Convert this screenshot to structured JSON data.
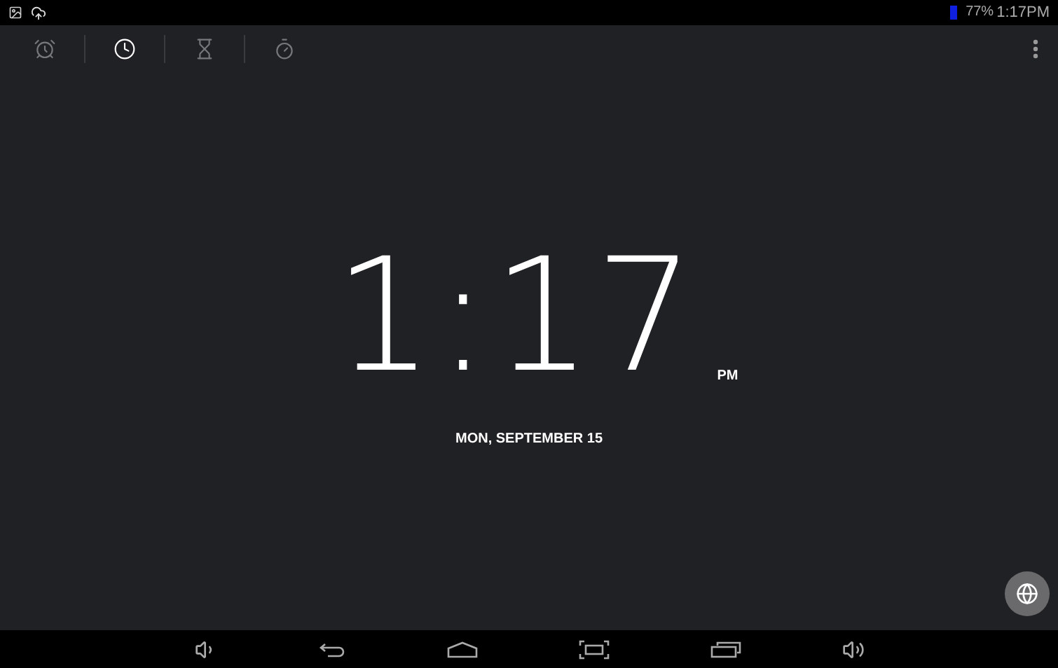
{
  "status_bar": {
    "battery_text": "77%",
    "time": "1:17PM"
  },
  "tabs": [
    {
      "kind": "alarm",
      "selected": false
    },
    {
      "kind": "clock",
      "selected": true
    },
    {
      "kind": "timer",
      "selected": false
    },
    {
      "kind": "stopwatch",
      "selected": false
    }
  ],
  "clock": {
    "time": "1:17",
    "meridiem": "PM",
    "date": "MON, SEPTEMBER 15"
  }
}
